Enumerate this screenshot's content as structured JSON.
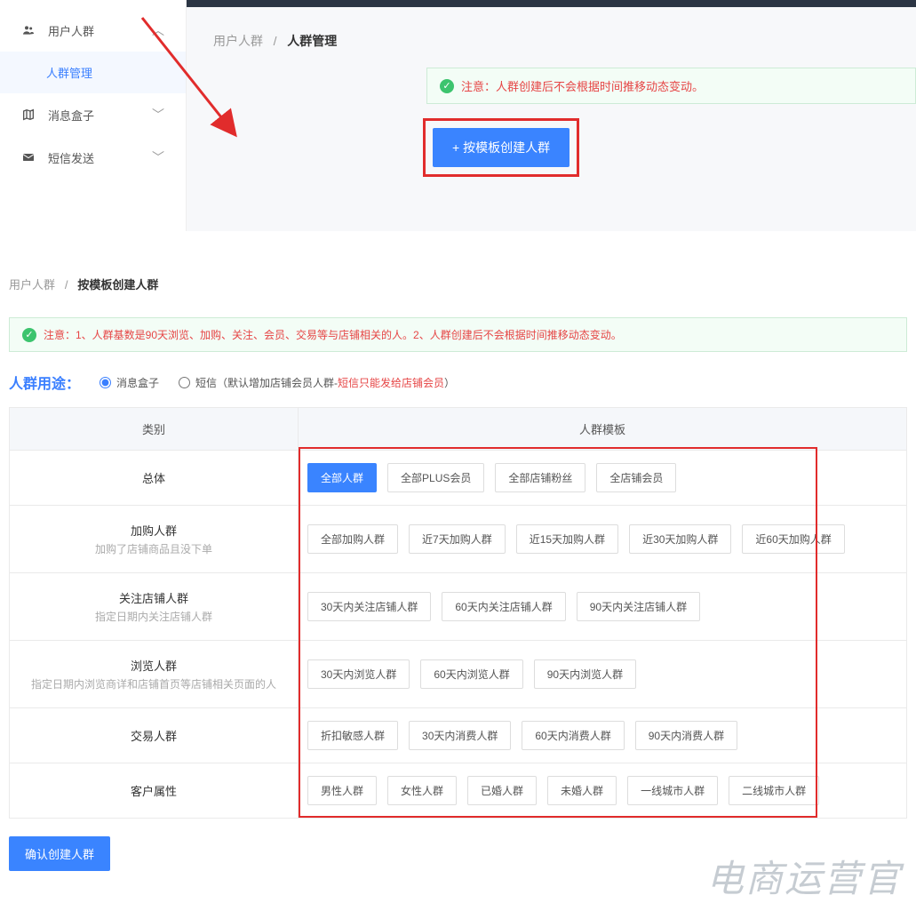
{
  "top": {
    "sidebar": {
      "users": "用户人群",
      "users_sub": "人群管理",
      "msgbox": "消息盒子",
      "sms": "短信发送"
    },
    "breadcrumb": {
      "root": "用户人群",
      "sep": "/",
      "current": "人群管理"
    },
    "alert": {
      "label": "注意：",
      "text": "人群创建后不会根据时间推移动态变动。"
    },
    "button": "+ 按模板创建人群"
  },
  "sec2": {
    "breadcrumb": {
      "root": "用户人群",
      "sep": "/",
      "current": "按模板创建人群"
    },
    "alert": "注意：1、人群基数是90天浏览、加购、关注、会员、交易等与店铺相关的人。2、人群创建后不会根据时间推移动态变动。",
    "purpose_label": "人群用途：",
    "radio_msgbox": "消息盒子",
    "radio_sms_pre": "短信（默认增加店铺会员人群-",
    "radio_sms_warn": "短信只能发给店铺会员",
    "radio_sms_suf": "）",
    "head_cat": "类别",
    "head_tmpl": "人群模板",
    "rows": [
      {
        "cat": "总体",
        "sub": "",
        "tags": [
          "全部人群",
          "全部PLUS会员",
          "全部店铺粉丝",
          "全店铺会员"
        ],
        "sel": 0
      },
      {
        "cat": "加购人群",
        "sub": "加购了店铺商品且没下单",
        "tags": [
          "全部加购人群",
          "近7天加购人群",
          "近15天加购人群",
          "近30天加购人群",
          "近60天加购人群"
        ],
        "sel": -1
      },
      {
        "cat": "关注店铺人群",
        "sub": "指定日期内关注店铺人群",
        "tags": [
          "30天内关注店铺人群",
          "60天内关注店铺人群",
          "90天内关注店铺人群"
        ],
        "sel": -1
      },
      {
        "cat": "浏览人群",
        "sub": "指定日期内浏览商详和店铺首页等店铺相关页面的人",
        "tags": [
          "30天内浏览人群",
          "60天内浏览人群",
          "90天内浏览人群"
        ],
        "sel": -1
      },
      {
        "cat": "交易人群",
        "sub": "",
        "tags": [
          "折扣敏感人群",
          "30天内消费人群",
          "60天内消费人群",
          "90天内消费人群"
        ],
        "sel": -1
      },
      {
        "cat": "客户属性",
        "sub": "",
        "tags": [
          "男性人群",
          "女性人群",
          "已婚人群",
          "未婚人群",
          "一线城市人群",
          "二线城市人群"
        ],
        "sel": -1
      }
    ],
    "confirm": "确认创建人群",
    "watermark": "电商运营官"
  }
}
